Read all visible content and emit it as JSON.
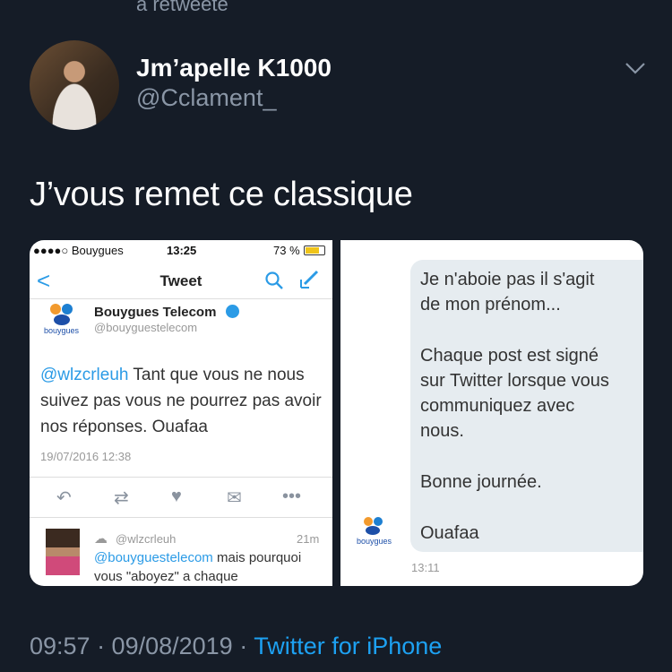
{
  "header": {
    "retweet_label": "a retweeté",
    "display_name": "Jm’apelle K1000",
    "handle": "@Cclament_"
  },
  "tweet": {
    "text": "J’vous remet ce classique",
    "timestamp": "09:57 · 09/08/2019",
    "separator": " · ",
    "source": "Twitter for iPhone"
  },
  "screenshot_left": {
    "status": {
      "carrier": "●●●●○ Bouygues",
      "time": "13:25",
      "battery_pct": "73 %",
      "battery_level": 0.73
    },
    "nav": {
      "back": "<",
      "title": "Tweet"
    },
    "brand": {
      "name": "Bouygues Telecom",
      "handle": "@bouyguestelecom",
      "logo_text": "bouygues"
    },
    "reply": {
      "mention": "@wlzcrleuh",
      "text": " Tant que vous ne nous suivez pas vous ne pourrez pas avoir nos réponses. Ouafaa",
      "date": "19/07/2016 12:38"
    },
    "actions": [
      "reply-icon",
      "retweet-icon",
      "like-icon",
      "dm-icon",
      "more-icon"
    ],
    "sub_reply": {
      "handle": "@wlzcrleuh",
      "time": "21m",
      "mention": "@bouyguestelecom",
      "text": " mais pourquoi vous \"aboyez\" a chaque"
    }
  },
  "screenshot_right": {
    "lines": [
      "Je n'aboie pas il s'agit",
      "de mon prénom...",
      "Chaque post est signé",
      "sur Twitter lorsque vous",
      "communiquez avec",
      "nous.",
      "Bonne journée.",
      "Ouafaa"
    ],
    "time": "13:11",
    "logo_text": "bouygues"
  },
  "colors": {
    "background": "#151c27",
    "secondary_text": "#8a96a6",
    "link": "#1da1f2"
  }
}
